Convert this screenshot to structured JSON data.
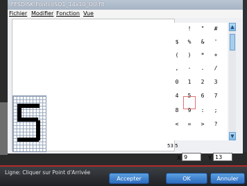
{
  "window": {
    "title": "\\FFSDISK\\Fonts\\ISO1_14x10_OU.flt"
  },
  "menu": {
    "items": [
      "Fichier",
      "Modifier",
      "Fonction",
      "Vue"
    ]
  },
  "char_table": {
    "rows": [
      [
        "",
        "!",
        "\"",
        "#"
      ],
      [
        "$",
        "%",
        "&",
        "'"
      ],
      [
        "(",
        ")",
        "*",
        "+"
      ],
      [
        ",",
        "-",
        ".",
        "/"
      ],
      [
        "0",
        "1",
        "2",
        "3"
      ],
      [
        "4",
        "5",
        "6",
        "7"
      ],
      [
        "8",
        "9",
        ":",
        ";"
      ],
      [
        "<",
        "=",
        ">",
        "?"
      ]
    ],
    "selected": "5"
  },
  "glyph": {
    "char": "5"
  },
  "char_code": "53 5",
  "coords": {
    "x_label": "X",
    "x_value": "9",
    "y_label": "Y",
    "y_value": "13"
  },
  "status": {
    "text": "Ligne: Cliquer sur Point d'Arrivée"
  },
  "buttons": {
    "accept": "Accepter",
    "ok": "OK",
    "cancel": "Annuler"
  },
  "colors": {
    "accent": "#2d6cc0",
    "status_line": "#b62b2b",
    "selection": "#e07070"
  }
}
